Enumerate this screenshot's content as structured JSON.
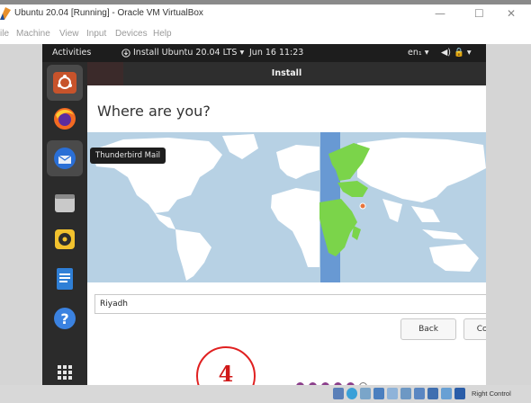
{
  "vbox": {
    "title": "Ubuntu 20.04 [Running] - Oracle VM VirtualBox",
    "controls": {
      "minimize": "—",
      "maximize": "☐",
      "close": "✕"
    },
    "menu": [
      "ile",
      "Machine",
      "View",
      "Input",
      "Devices",
      "Help"
    ],
    "host_key": "Right Control"
  },
  "topbar": {
    "activities": "Activities",
    "app_menu": "Install Ubuntu 20.04 LTS ▾",
    "clock": "Jun 16  11:23",
    "keyboard": "en₁ ▾",
    "system_tray": "◀)  🔒  ▾"
  },
  "dock": {
    "tooltip": "Thunderbird Mail",
    "items": [
      {
        "name": "ubuntu-installer-icon",
        "active": true
      },
      {
        "name": "firefox-icon"
      },
      {
        "name": "thunderbird-icon"
      },
      {
        "name": "files-icon"
      },
      {
        "name": "rhythmbox-icon"
      },
      {
        "name": "writer-icon"
      },
      {
        "name": "help-icon"
      },
      {
        "name": "show-apps-icon"
      }
    ]
  },
  "installer": {
    "window_title": "Install",
    "heading": "Where are you?",
    "city_value": "Riyadh",
    "back_label": "Back",
    "continue_label": "Continue"
  },
  "annotation": {
    "step_number": "4"
  },
  "progress": {
    "total_steps": 6,
    "completed_steps": 5
  },
  "colors": {
    "selected_region": "#7bd44a",
    "timezone_band": "#5b8fd0",
    "ocean": "#b7d1e4",
    "land": "#ffffff",
    "dot_filled": "#8b3f8b",
    "annotation_red": "#e02020"
  }
}
